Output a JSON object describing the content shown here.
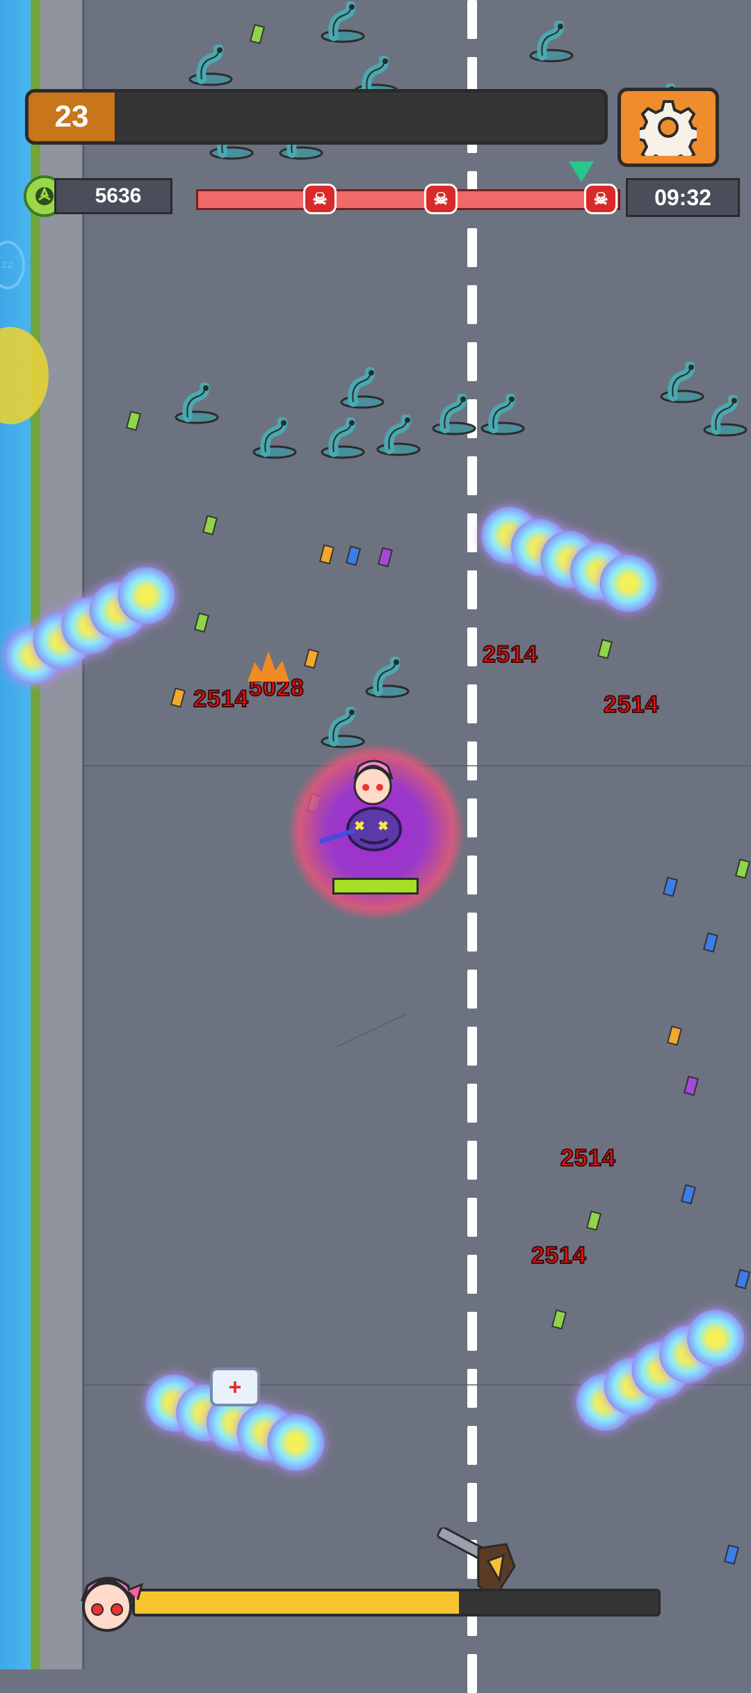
{
  "hud": {
    "level": "23",
    "xp_fraction": 0.0,
    "coins": "5636",
    "timer": "09:32",
    "wave_progress_fraction": 0.95,
    "boss_progress_fraction": 0.62,
    "player_hp_fraction": 1.0
  },
  "icons": {
    "settings": "gear-icon",
    "coin": "coin-icon",
    "boss_marker": "skull-icon",
    "wave_marker": "triangle-marker-icon",
    "player_portrait": "hero-portrait-icon",
    "medkit": "medkit-icon"
  },
  "damage_numbers": [
    "2514",
    "5028",
    "2514",
    "2514",
    "2514",
    "2514"
  ],
  "colors": {
    "level_badge": "#c8751c",
    "settings_button": "#ef8d2c",
    "wave_bar": "#f06a6a",
    "boss_bar": "#f7c430",
    "hp_bar": "#a6df24",
    "damage_text": "#e81414"
  }
}
